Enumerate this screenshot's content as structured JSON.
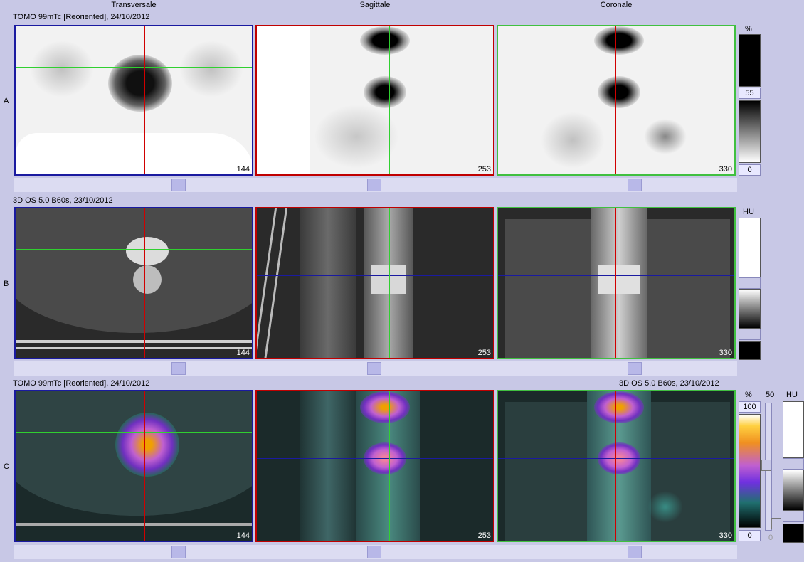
{
  "columns": [
    "Transversale",
    "Sagittale",
    "Coronale"
  ],
  "rows": {
    "A": {
      "letter": "A",
      "series": "TOMO 99mTc [Reoriented], 24/10/2012"
    },
    "B": {
      "letter": "B",
      "series": "3D  OS  5.0  B60s, 23/10/2012"
    },
    "C": {
      "letter": "C",
      "series_left": "TOMO 99mTc [Reoriented], 24/10/2012",
      "series_right": "3D  OS  5.0  B60s, 23/10/2012"
    }
  },
  "slices": [
    "144",
    "253",
    "330"
  ],
  "scale_a": {
    "unit": "%",
    "upper": "55",
    "lower": "0"
  },
  "scale_b": {
    "unit": "HU"
  },
  "scale_c": {
    "unit": "%",
    "upper": "100",
    "lower": "0",
    "mix_label": "50",
    "mix_zero": "0",
    "unit2": "HU"
  },
  "colors": {
    "transversal": "#1a1aa0",
    "sagittal": "#c00000",
    "coronal": "#40c040",
    "crosshair_h": "#30d030",
    "crosshair_v": "#d00000"
  }
}
